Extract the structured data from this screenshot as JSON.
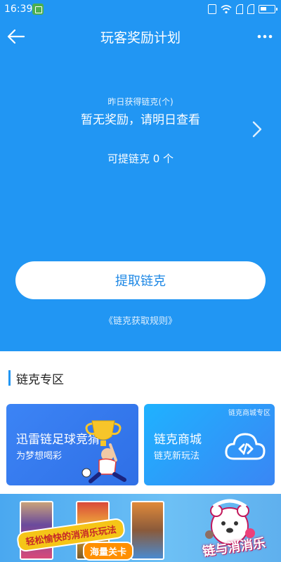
{
  "status_bar": {
    "time": "16:39"
  },
  "nav": {
    "title": "玩客奖励计划"
  },
  "rewards": {
    "yesterday_label": "昨日获得链克(个)",
    "yesterday_value": "暂无奖励，请明日查看",
    "available_text": "可提链克 0 个",
    "withdraw_label": "提取链克",
    "rules_link": "《链克获取规则》"
  },
  "zone": {
    "title": "链克专区",
    "cards": [
      {
        "title": "迅雷链足球竞猜",
        "subtitle": "为梦想喝彩"
      },
      {
        "title": "链克商城",
        "subtitle": "链克新玩法",
        "tag": "链克商城专区"
      }
    ]
  },
  "banner": {
    "slogan": "轻松愉快的消消乐玩法",
    "tagline": "海量关卡",
    "logo_text": "链与消消乐"
  },
  "colors": {
    "primary": "#2196f3",
    "button_text": "#1e88e5"
  }
}
